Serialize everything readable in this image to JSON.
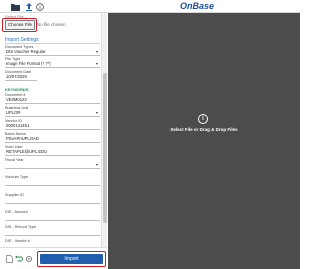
{
  "app": {
    "brand": "OnBase"
  },
  "upload": {
    "select_file_label": "Select File",
    "choose_file_label": "Choose File",
    "no_file_text": "No file chosen"
  },
  "import_settings": {
    "title": "Import Settings",
    "document_types_label": "Document Types",
    "document_types_value": "DIS Voucher Regular",
    "file_type_label": "File Type",
    "file_type_value": "Image File Format (*.?*)",
    "document_date_label": "Document Date",
    "document_date_value": "10/07/2020"
  },
  "keywords": {
    "title": "KEYWORDS",
    "document_number_label": "Document #",
    "document_number_value": "VE0M0123",
    "business_unit_label": "Business Unit",
    "business_unit_value": "UPLOR",
    "vendor_id_label": "Vendor ID",
    "vendor_id_value": "0000131451",
    "batch_name_label": "Batch Name",
    "batch_name_value": "PSvAPnUPLOAD",
    "scan_user_label": "Scan User",
    "scan_user_value": "RETAPLE@UPL.EDU",
    "fiscal_year_label": "Fiscal Year",
    "fiscal_year_value": "",
    "voucher_type_label": "Voucher Type",
    "supplier_id_label": "Supplier ID",
    "dis_amount_label": "DIS - Amount",
    "dis_record_type_label": "DIS - Record Type",
    "dis_vendor_label": "DIS - Vendor #"
  },
  "actions": {
    "import_label": "Import"
  },
  "dropzone": {
    "text": "Select File or Drag & Drop Files"
  },
  "colors": {
    "brand": "#1f4e96",
    "import_button": "#1f5fae",
    "highlight": "#d11a2a",
    "dropzone_bg": "#4c4c4c"
  }
}
